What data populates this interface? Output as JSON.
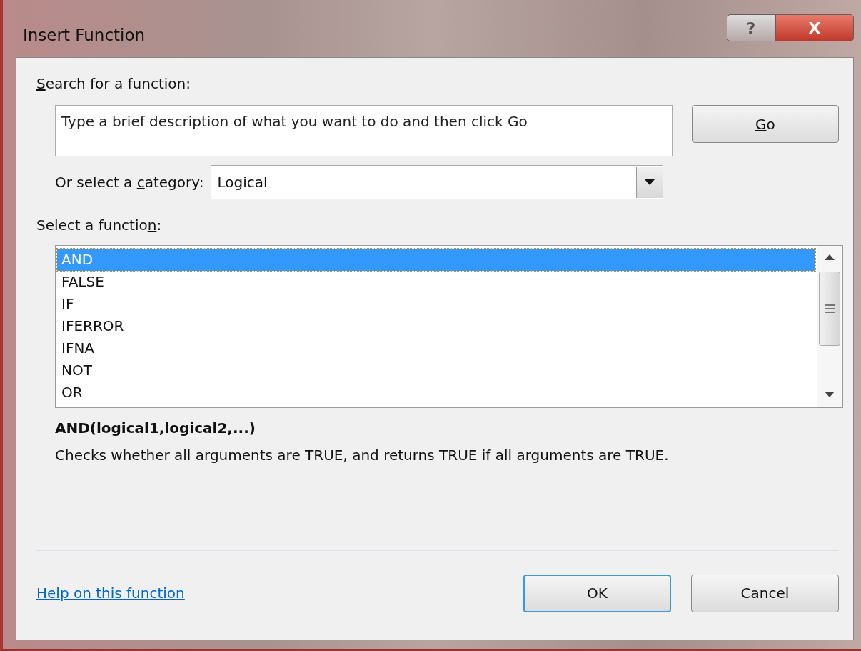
{
  "window": {
    "title": "Insert Function",
    "buttons": [
      {
        "kind": "help",
        "label": "?"
      },
      {
        "kind": "close",
        "label": "X"
      }
    ]
  },
  "search": {
    "label": [
      {
        "kind": "access_key",
        "text": "S"
      },
      {
        "kind": "plain",
        "text": "earch for a function:"
      }
    ],
    "placeholder": "Type a brief description of what you want to do and then click Go",
    "button": {
      "label": [
        {
          "kind": "access_key",
          "text": "G"
        },
        {
          "kind": "plain",
          "text": "o"
        }
      ]
    }
  },
  "category": {
    "label": [
      {
        "kind": "plain",
        "text": "Or select a "
      },
      {
        "kind": "access_key",
        "text": "c"
      },
      {
        "kind": "plain",
        "text": "ategory:"
      }
    ],
    "value": "Logical"
  },
  "function_list": {
    "label": [
      {
        "kind": "plain",
        "text": "Select a functio"
      },
      {
        "kind": "access_key",
        "text": "n"
      },
      {
        "kind": "plain",
        "text": ":"
      }
    ],
    "items": [
      {
        "label": "AND",
        "selected": true
      },
      {
        "label": "FALSE",
        "selected": false
      },
      {
        "label": "IF",
        "selected": false
      },
      {
        "label": "IFERROR",
        "selected": false
      },
      {
        "label": "IFNA",
        "selected": false
      },
      {
        "label": "NOT",
        "selected": false
      },
      {
        "label": "OR",
        "selected": false
      }
    ]
  },
  "signature": "AND(logical1,logical2,...)",
  "description": "Checks whether all arguments are TRUE, and returns TRUE if all arguments are TRUE.",
  "help_link": "Help on this function",
  "buttons": [
    {
      "label": "OK",
      "default": true
    },
    {
      "label": "Cancel",
      "default": false
    }
  ]
}
